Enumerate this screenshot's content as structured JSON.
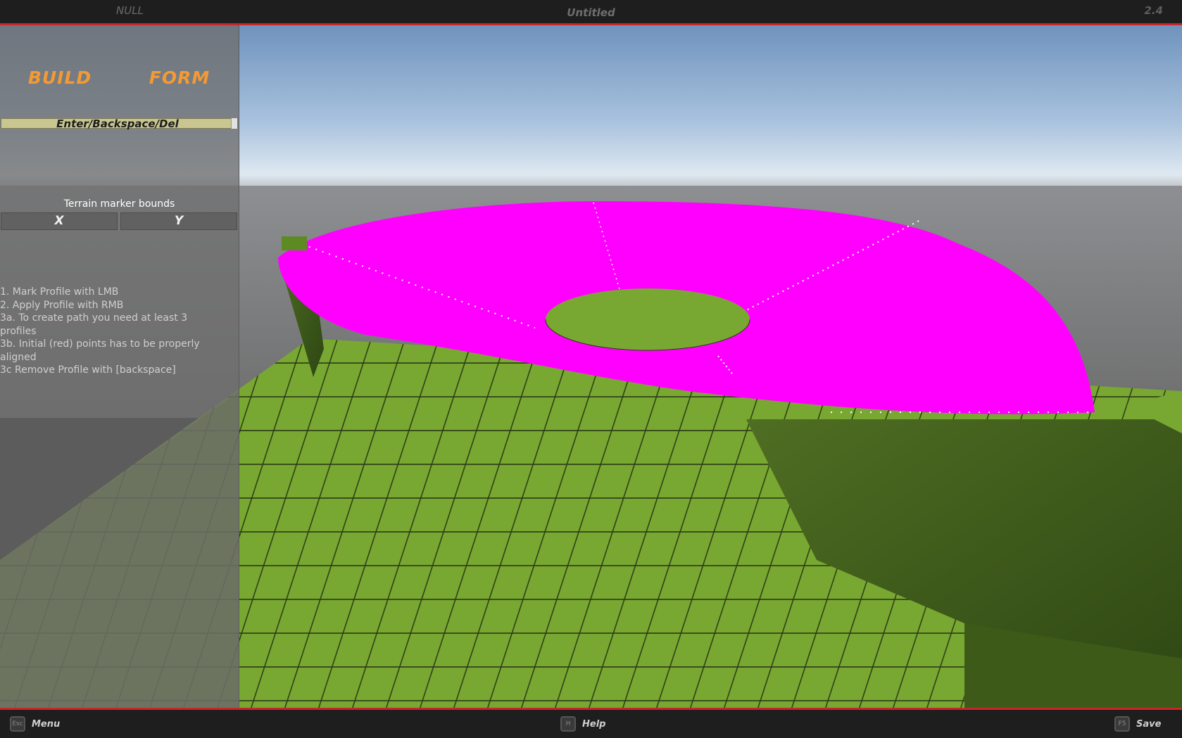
{
  "topbar": {
    "left_status": "NULL",
    "title": "Untitled",
    "version": "2.4"
  },
  "panel": {
    "modes": {
      "build": "BUILD",
      "form": "FORM"
    },
    "hint": "Enter/Backspace/Del",
    "bounds_label": "Terrain marker bounds",
    "axis_x": "X",
    "axis_y": "Y",
    "instructions": [
      "1. Mark Profile with LMB",
      "2. Apply Profile with RMB",
      "3a. To create path you need at least 3 profiles",
      "3b. Initial (red) points has to be properly aligned",
      "3c Remove Profile with [backspace]"
    ]
  },
  "bottombar": {
    "menu": {
      "key": "Esc",
      "label": "Menu"
    },
    "help": {
      "key": "H",
      "label": "Help"
    },
    "save": {
      "key": "F5",
      "label": "Save"
    }
  },
  "colors": {
    "accent": "#f39a34",
    "frame_red": "#c8262a",
    "terrain_marker": "#ff00ff",
    "grass": "#6f9e2c"
  }
}
